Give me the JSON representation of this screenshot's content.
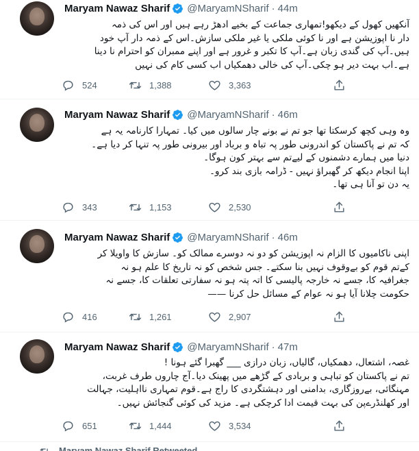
{
  "colors": {
    "verified": "#1d9bf0",
    "muted": "#536471",
    "text": "#0f1419",
    "divider": "#eff3f4"
  },
  "tweets": [
    {
      "name": "Maryam Nawaz Sharif",
      "handle": "@MaryamNSharif",
      "dot": "·",
      "time": "44m",
      "lines": [
        "آنکھیں کھول کے دیکھو!تمھاری جماعت کے بخیے ادھڑ رہے ہیں اور اس کی ذمہ",
        "دار نا اپوزیشن ہے اور نا کوئی ملکی یا غیر ملکی سازش۔اس کے ذمہ دار آپ خود",
        "ہیں۔آپ کی گندی زبان ہے۔آپ کا تکبر و غرور ہے اور اپنے ممبران کو احترام نا دینا",
        "ہے۔اب بہت دیر ہو چکی۔آپ کی خالی دھمکیاں اب کسی کام کی نہیں"
      ],
      "replies": "524",
      "retweets": "1,388",
      "likes": "3,363"
    },
    {
      "name": "Maryam Nawaz Sharif",
      "handle": "@MaryamNSharif",
      "dot": "·",
      "time": "46m",
      "lines": [
        "وہ وہی کچھ کرسکتا تھا جو تم نے بونے چار سالوں میں کیا۔ تمہارا کارنامہ یہ ہے",
        "کہ تم نے پاکستان کو اندرونی طور پہ تباہ و برباد اور بیرونی طور پہ تنہا کر دیا ہے۔",
        "دنیا میں ہمارے دشمنوں کے لیےتم سے بہتر کون ہوگا۔",
        "اپنا انجام دیکھ کر گھبراؤ نہیں - ڈرامہ بازی بند کرو۔",
        "یہ دن تو آنا ہی تھا۔"
      ],
      "replies": "343",
      "retweets": "1,153",
      "likes": "2,530"
    },
    {
      "name": "Maryam Nawaz Sharif",
      "handle": "@MaryamNSharif",
      "dot": "·",
      "time": "46m",
      "lines": [
        "اپنی ناکامیوں کا الزام نہ اپوزیشن کو دو نہ دوسرے ممالک کو۔ سازش کا واویلا کر",
        "کےتم قوم کو بےوقوف نہیں بنا سکتے۔ جس شخص کو نہ تاریخ کا علم ہو نہ",
        "جغرافیہ کا، جسے نہ خارجہ پالیسی کا اتہ پتہ ہو نہ سفارتی تعلقات کا، جسے نہ",
        "حکومت چلانا آیا ہو نہ عوام کے مسائل حل کرنا ——"
      ],
      "replies": "416",
      "retweets": "1,261",
      "likes": "2,907"
    },
    {
      "name": "Maryam Nawaz Sharif",
      "handle": "@MaryamNSharif",
      "dot": "·",
      "time": "47m",
      "lines": [
        "غصہ، اشتعال، دھمکیاں، گالیاں، زبان درازی ___ گھبرا گئے ہونا !",
        "تم نے پاکستان کو تباہی و بربادی کے گڑھے میں پھینک دیا۔آج چاروں طرف غربت،",
        "مہنگائی، بےروزگاری، بدامنی اور دہشتگردی کا راج ہے۔قوم تمہاری نااہلیت، جہالت",
        "اور کھلنڈرےپن کی بہت قیمت ادا کرچکی ہے۔ مزید کی کوئی گنجائش نہیں۔"
      ],
      "replies": "651",
      "retweets": "1,444",
      "likes": "3,534"
    }
  ],
  "retweeted_label": "Maryam Nawaz Sharif Retweeted"
}
